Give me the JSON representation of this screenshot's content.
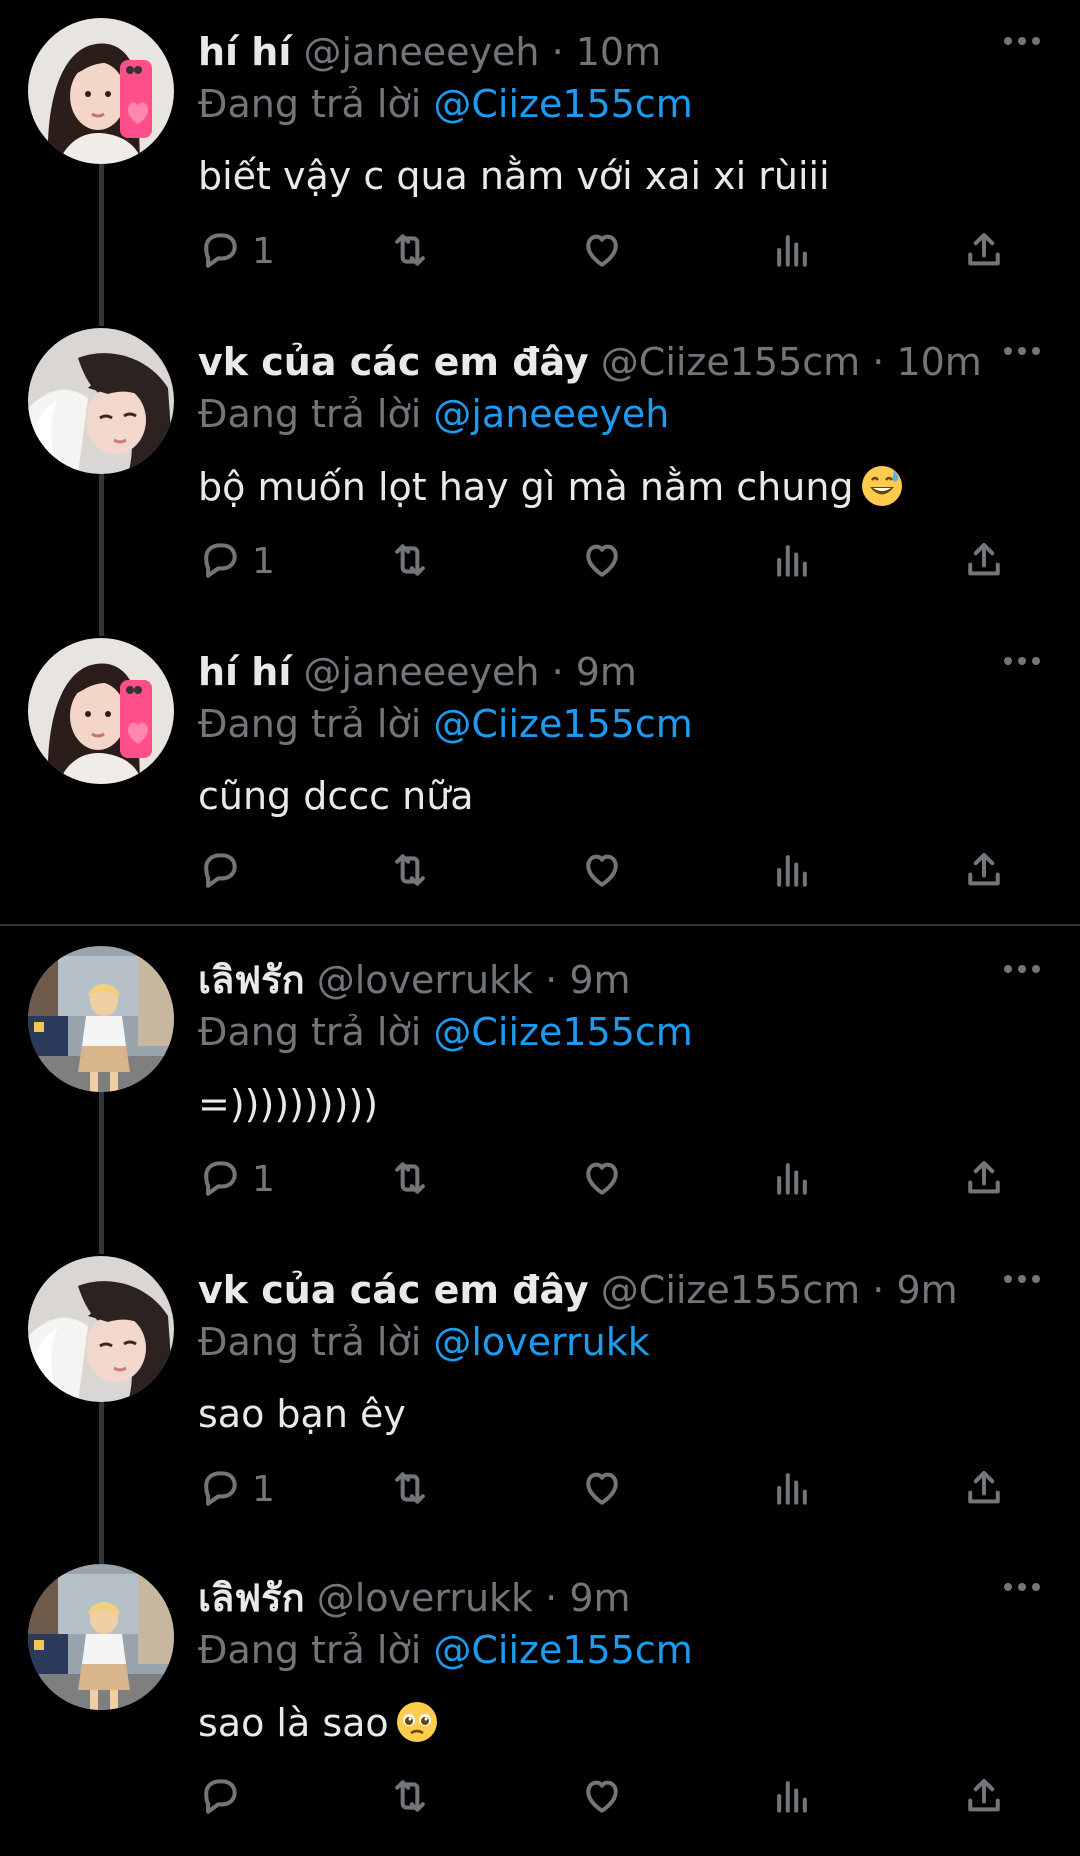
{
  "replying_prefix": "Đang trả lời",
  "tweets": [
    {
      "name": "hí hí",
      "handle": "@janeeeyeh",
      "time": "10m",
      "reply_to": "@Ciize155cm",
      "text": "biết vậy c qua nằm với xai xi rùiii",
      "reply_count": "1",
      "avatar": "avatar-girl-pink-phone"
    },
    {
      "name": "vk của các em đây",
      "handle": "@Ciize155cm",
      "time": "10m",
      "reply_to": "@janeeeyeh",
      "text": "bộ muốn lọt hay gì mà nằm chung",
      "emoji": "grinning-sweat-emoji",
      "reply_count": "1",
      "avatar": "avatar-girl-lying"
    },
    {
      "name": "hí hí",
      "handle": "@janeeeyeh",
      "time": "9m",
      "reply_to": "@Ciize155cm",
      "text": "cũng dccc nữa",
      "reply_count": "",
      "avatar": "avatar-girl-pink-phone"
    },
    {
      "name": "เลิฟรัก",
      "handle": "@loverrukk",
      "time": "9m",
      "reply_to": "@Ciize155cm",
      "text": "=))))))))))",
      "reply_count": "1",
      "avatar": "avatar-girl-street"
    },
    {
      "name": "vk của các em đây",
      "handle": "@Ciize155cm",
      "time": "9m",
      "reply_to": "@loverrukk",
      "text": "sao bạn êy",
      "reply_count": "1",
      "avatar": "avatar-girl-lying"
    },
    {
      "name": "เลิฟรัก",
      "handle": "@loverrukk",
      "time": "9m",
      "reply_to": "@Ciize155cm",
      "text": "sao là sao",
      "emoji": "pleading-face-emoji",
      "reply_count": "",
      "avatar": "avatar-girl-street"
    }
  ],
  "icons": {
    "reply": "reply-icon",
    "retweet": "retweet-icon",
    "like": "heart-icon",
    "views": "views-icon",
    "share": "share-icon",
    "more": "more-icon"
  },
  "colors": {
    "background": "#000000",
    "text": "#e7e9ea",
    "muted": "#71767b",
    "mention": "#1d9bf0",
    "thread_line": "#333639"
  }
}
